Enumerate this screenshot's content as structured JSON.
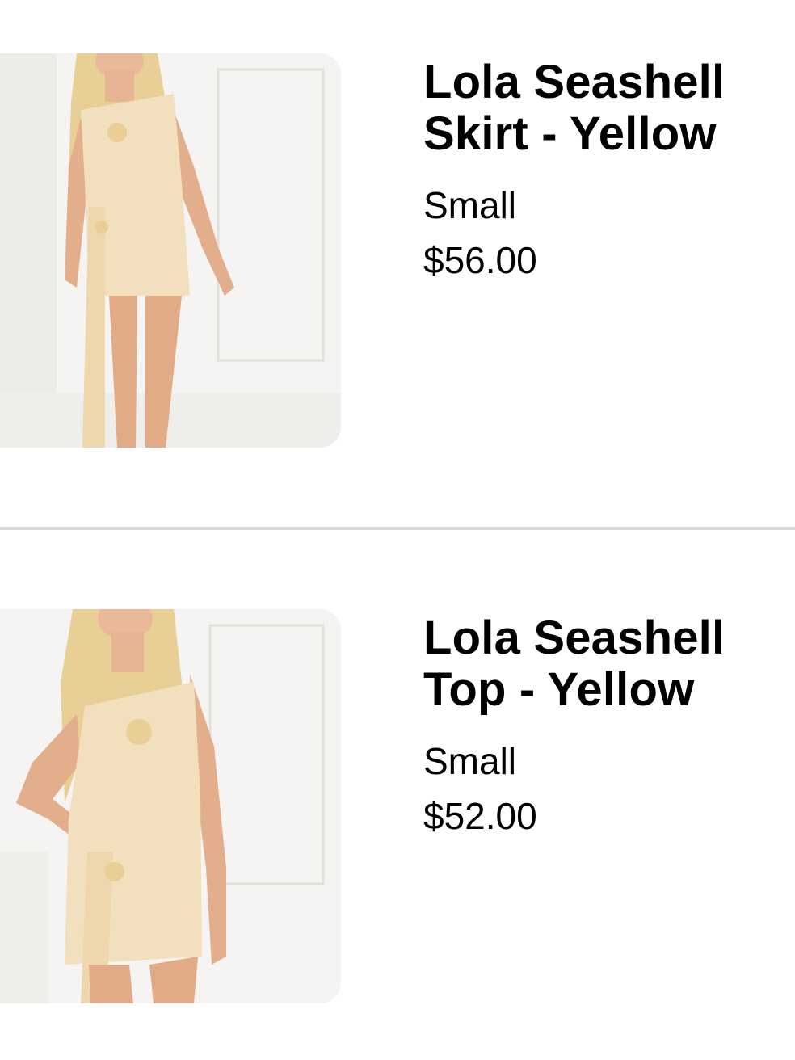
{
  "cart": {
    "items": [
      {
        "title": "Lola Seashell Skirt - Yellow",
        "variant": "Small",
        "price": "$56.00",
        "image_icon": "product-photo"
      },
      {
        "title": "Lola Seashell Top - Yellow",
        "variant": "Small",
        "price": "$52.00",
        "image_icon": "product-photo"
      }
    ]
  },
  "colors": {
    "background": "#ffffff",
    "divider": "#d6d6d6",
    "text": "#000000",
    "garment": "#f2dfbd"
  }
}
